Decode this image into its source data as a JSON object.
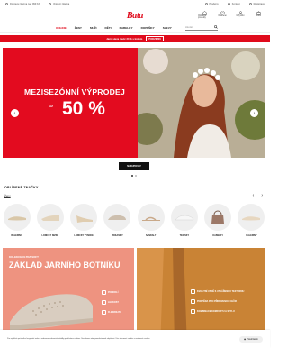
{
  "util": {
    "left": [
      "Doprava zdarma nad 999 Kč",
      "Vrácení zdarma"
    ],
    "right": [
      "Prodejny",
      "Kontakt",
      "Registrace"
    ]
  },
  "brand": "Bata",
  "header_icons": [
    {
      "name": "wishlist",
      "label": "Oblíbené produkty"
    },
    {
      "name": "favorites",
      "label": "Oblíbené"
    },
    {
      "name": "account",
      "label": "Můj účet"
    },
    {
      "name": "cart",
      "label": "Košík"
    }
  ],
  "nav": {
    "items": [
      "ONLINE",
      "ŽENY",
      "MUŽI",
      "DĚTI",
      "KABELKY",
      "DOPLŇKY",
      "SLEVY"
    ],
    "active_index": 0,
    "search_placeholder": "Hledat"
  },
  "promo": {
    "text": "Jarní sleva navíc 20 % s kódem",
    "code": "PODZIM20"
  },
  "hero": {
    "title": "MEZISEZÓNNÍ VÝPRODEJ",
    "prefix": "AŽ",
    "percent": "50 %",
    "cta": "NAKUPOVAT"
  },
  "brands_section": {
    "title": "OBLÍBENÉ ZNAČKY",
    "subtitle": "Ženy",
    "categories": [
      "BALERÍNY",
      "LODIČKY NÍZKÉ",
      "LODIČKY VYSOKÉ",
      "MOKASÍNY",
      "SANDÁLY",
      "TENISKY",
      "KABELKY",
      "BALERÍNY"
    ]
  },
  "lower_left": {
    "small": "KOLEKCE ULTRA SOFT",
    "title": "ZÁKLAD JARNÍHO BOTNÍKU",
    "features": [
      "POHODLÍ",
      "LEHKOST",
      "FLEXIBILITA"
    ]
  },
  "lower_right": {
    "features": [
      "KVALITNÍ USNĚ S UTVÁŘENOU TEXTUROU",
      "PODPĚRA PRO PŘIROZENOU CHŮZI",
      "KOMBINACE KOMFORTU A STYLU"
    ]
  },
  "cookie": {
    "text": "Pro zajištění správného fungování webu a zobrazení relevantní nabídky používáme cookies. Souhlasem nám pomůžete web zlepšovat. Více informací najdete v nastavení cookies.",
    "button": "Souhlasím"
  },
  "colors": {
    "accent": "#e00b1c",
    "salmon": "#ee9380",
    "caramel": "#bf7a2c"
  }
}
